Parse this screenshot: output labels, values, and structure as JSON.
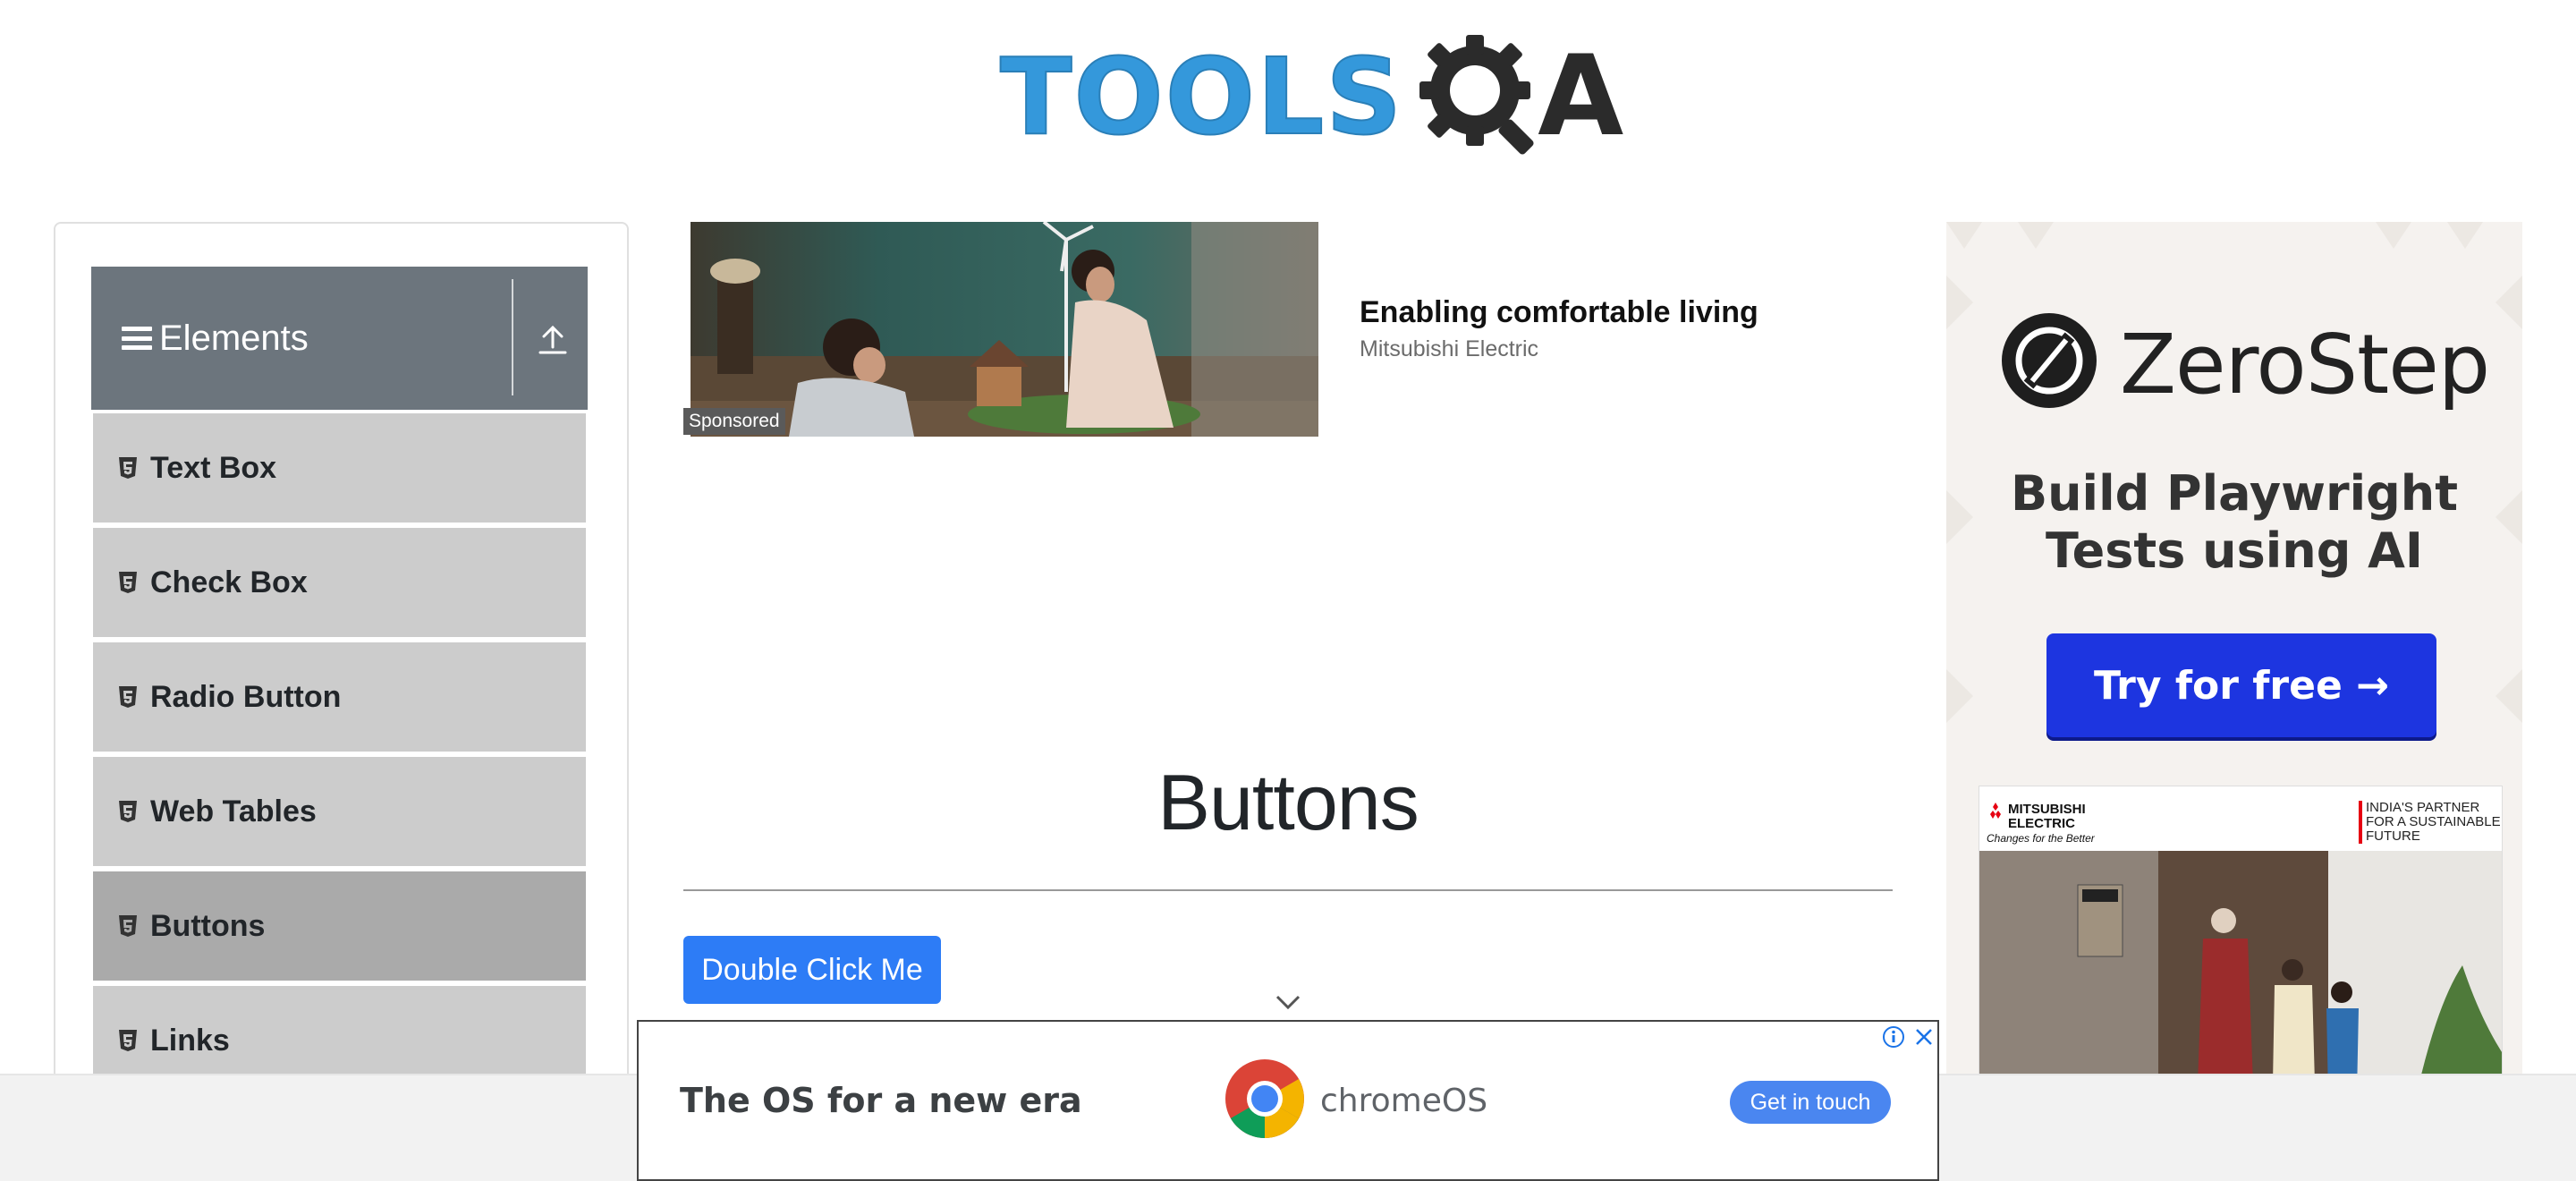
{
  "header": {
    "logo_part1": "TOOLS",
    "logo_part2": "A"
  },
  "sidebar": {
    "group_title": "Elements",
    "items": [
      {
        "label": "Text Box"
      },
      {
        "label": "Check Box"
      },
      {
        "label": "Radio Button"
      },
      {
        "label": "Web Tables"
      },
      {
        "label": "Buttons",
        "active": true
      },
      {
        "label": "Links"
      }
    ]
  },
  "top_ad": {
    "badge": "Sponsored",
    "title": "Enabling comfortable living",
    "advertiser": "Mitsubishi Electric"
  },
  "main": {
    "title": "Buttons",
    "double_click_label": "Double Click Me"
  },
  "right_ad": {
    "brand": "ZeroStep",
    "tagline_line1": "Build Playwright",
    "tagline_line2": "Tests using AI",
    "cta": "Try for free →",
    "mitsu_brand_line1": "MITSUBISHI",
    "mitsu_brand_line2": "ELECTRIC",
    "mitsu_slogan": "Changes for the Better",
    "mitsu_right_line1": "INDIA'S PARTNER",
    "mitsu_right_line2": "FOR A SUSTAINABLE",
    "mitsu_right_line3": "FUTURE"
  },
  "bottom_ad": {
    "headline": "The OS for a new era",
    "product": "chromeOS",
    "cta": "Get in touch"
  },
  "colors": {
    "primary_button": "#2d7cf6",
    "menu_header": "#6c757d",
    "menu_item": "#cccccc",
    "menu_active": "#aaaaaa",
    "logo_blue": "#3498db",
    "zerostep_button": "#1d35e0"
  }
}
